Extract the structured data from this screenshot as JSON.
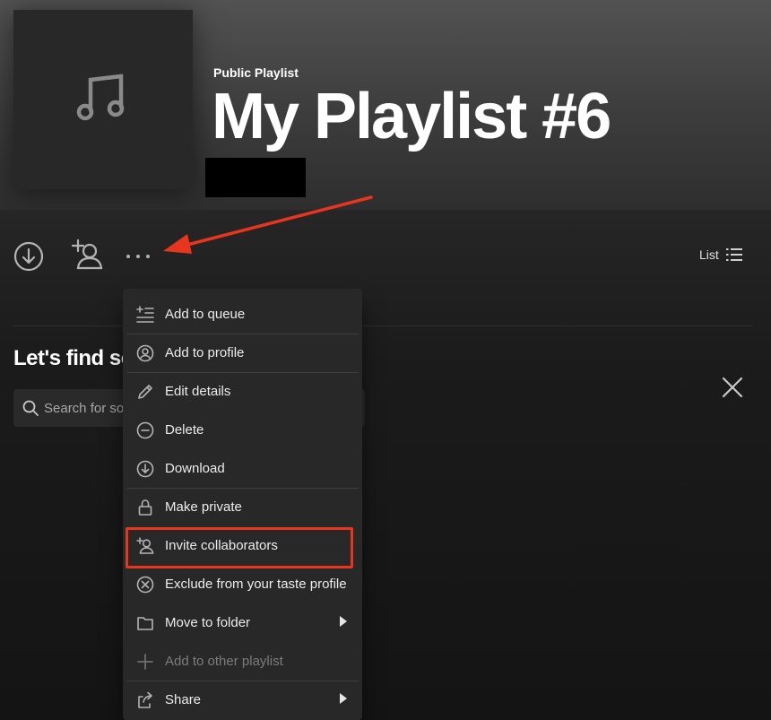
{
  "header": {
    "playlist_type": "Public Playlist",
    "title": "My Playlist #6",
    "cover_icon": "music-note-icon",
    "owner_redacted": true
  },
  "actions": {
    "download_icon": "download-circle-icon",
    "invite_icon": "add-person-icon",
    "more_icon": "more-dots-icon",
    "view_label": "List",
    "view_icon": "list-icon"
  },
  "recommend": {
    "heading_visible": "Let's find so",
    "heading_trailing": ":",
    "search_placeholder": "Search for so"
  },
  "menu": {
    "items": [
      {
        "label": "Add to queue",
        "icon": "add-to-queue-icon"
      },
      {
        "label": "Add to profile",
        "icon": "profile-icon"
      },
      {
        "label": "Edit details",
        "icon": "pencil-icon"
      },
      {
        "label": "Delete",
        "icon": "minus-circle-icon"
      },
      {
        "label": "Download",
        "icon": "download-circle-icon"
      },
      {
        "label": "Make private",
        "icon": "lock-icon"
      },
      {
        "label": "Invite collaborators",
        "icon": "add-person-icon"
      },
      {
        "label": "Exclude from your taste profile",
        "icon": "x-circle-icon"
      },
      {
        "label": "Move to folder",
        "icon": "folder-icon",
        "submenu": true
      },
      {
        "label": "Add to other playlist",
        "icon": "plus-icon",
        "disabled": true
      },
      {
        "label": "Share",
        "icon": "share-icon",
        "submenu": true
      }
    ]
  },
  "annotation": {
    "highlighted_item": "Invite collaborators",
    "color": "#e8361e"
  },
  "colors": {
    "background": "#121212",
    "menu_background": "#282828",
    "text": "#ffffff",
    "muted_text": "#a7a7a7"
  }
}
